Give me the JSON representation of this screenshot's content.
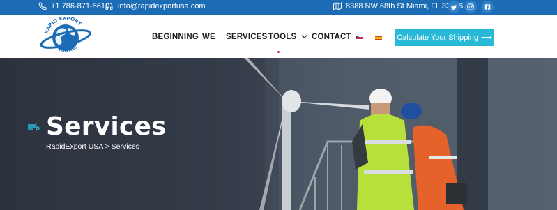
{
  "topbar": {
    "phone": "+1 786-871-5610",
    "email": "info@rapidexportusa.com",
    "address": "8388 NW 68th St Miami, FL 33166.",
    "social": [
      {
        "name": "twitter",
        "glyph": "t"
      },
      {
        "name": "instagram",
        "glyph": "◎"
      },
      {
        "name": "facebook",
        "glyph": "f"
      }
    ]
  },
  "header": {
    "logo": {
      "top_text": "RAPID EXPORT",
      "bottom_text": "SERVICES"
    },
    "nav": [
      "BEGINNING",
      "WE",
      "SERVICES",
      "TOOLS",
      "CONTACT"
    ],
    "languages": [
      "en",
      "es"
    ],
    "cta_label": "Calculate Your Shipping",
    "cta_arrow": "⟶"
  },
  "hero": {
    "title": "Services",
    "breadcrumb": "RapidExport USA > Services"
  },
  "colors": {
    "topbar": "#1b6bb5",
    "accent": "#28b9d6",
    "nav_text": "#1e1e1e",
    "active_dot": "#e0262b"
  },
  "icons": [
    "phone-icon",
    "mail-icon",
    "map-icon",
    "chevron-down-icon",
    "wind-icon"
  ]
}
